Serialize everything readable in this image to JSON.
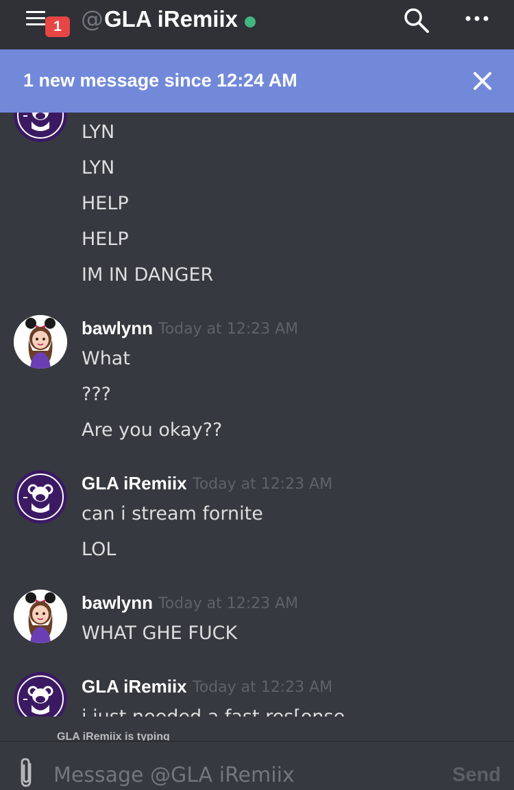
{
  "colors": {
    "background": "#36393f",
    "topbar": "#2f3136",
    "banner": "#7289da",
    "badge": "#e84545",
    "online": "#43b581",
    "avatar_bot": "#3b1a63"
  },
  "header": {
    "notification_count": "1",
    "at_symbol": "@",
    "channel_name": "GLA iRemiix",
    "menu_icon": "hamburger-icon",
    "search_icon": "search-icon",
    "more_icon": "more-icon"
  },
  "banner": {
    "text": "1 new message since 12:24 AM",
    "close_icon": "close-icon"
  },
  "messages": {
    "g0": {
      "lines": [
        "LYN",
        "LYN",
        "HELP",
        "HELP",
        "IM IN DANGER"
      ]
    },
    "g1": {
      "author": "bawlynn",
      "timestamp": "Today at 12:23 AM",
      "lines": [
        "What",
        "???",
        "Are you okay??"
      ]
    },
    "g2": {
      "author": "GLA iRemiix",
      "timestamp": "Today at 12:23 AM",
      "lines": [
        "can i stream fornite",
        "LOL"
      ]
    },
    "g3": {
      "author": "bawlynn",
      "timestamp": "Today at 12:23 AM",
      "lines": [
        "WHAT GHE FUCK"
      ]
    },
    "g4": {
      "author": "GLA iRemiix",
      "timestamp": "Today at 12:23 AM",
      "lines": [
        "i just needed a fast res[onse"
      ]
    }
  },
  "typing_indicator": "GLA iRemiix is typing",
  "composer": {
    "placeholder": "Message @GLA iRemiix",
    "send_label": "Send",
    "attach_icon": "paperclip-icon"
  }
}
